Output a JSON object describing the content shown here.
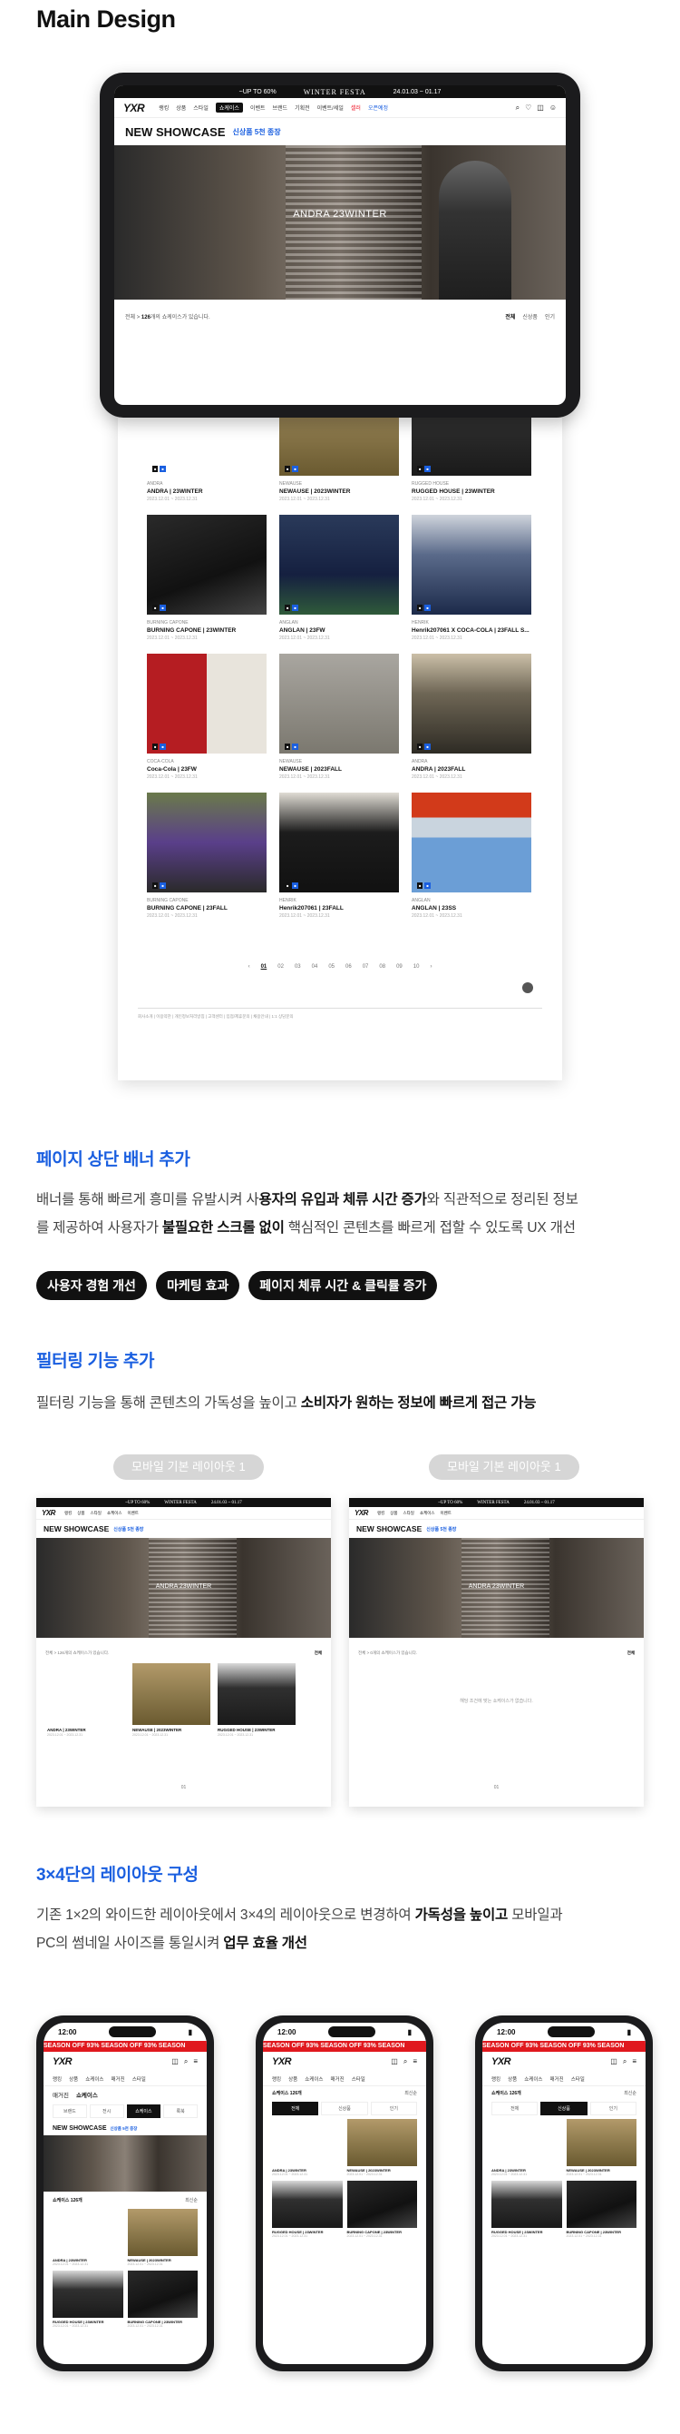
{
  "heading": "Main Design",
  "site": {
    "logo": "YXR",
    "promo_left": "~UP TO 60%",
    "promo_center": "WINTER FESTA",
    "promo_right": "24.01.03 ~ 01.17",
    "menu": [
      "랭킹",
      "상품",
      "스타일",
      "쇼케이스",
      "이벤트",
      "브랜드",
      "기획전",
      "이벤트/세일",
      "셀러",
      "오픈예정"
    ],
    "menu_active_index": 3,
    "menu_red_index": 8,
    "menu_blue_index": 9,
    "icons": [
      "search-icon",
      "heart-icon",
      "cart-icon",
      "user-icon"
    ]
  },
  "showcase": {
    "title": "NEW SHOWCASE",
    "subtitle": "신상품 5천 종장",
    "hero_label": "ANDRA 23WINTER",
    "result_text_prefix": "전체 > ",
    "result_count": "126",
    "result_text_suffix": "개의 쇼케이스가 있습니다.",
    "sort": [
      "전체",
      "신상품",
      "인기"
    ]
  },
  "cards": [
    {
      "brand": "ANDRA",
      "title": "ANDRA | 23WINTER",
      "date": "2023.12.01 ~ 2023.12.31",
      "thumb": "t1"
    },
    {
      "brand": "NEWAUSE",
      "title": "NEWAUSE | 2023WINTER",
      "date": "2023.12.01 ~ 2023.12.31",
      "thumb": "t2"
    },
    {
      "brand": "RUGGED HOUSE",
      "title": "RUGGED HOUSE | 23WINTER",
      "date": "2023.12.01 ~ 2023.12.31",
      "thumb": "t3"
    },
    {
      "brand": "BURNING CAPONE",
      "title": "BURNING CAPONE | 23WINTER",
      "date": "2023.12.01 ~ 2023.12.31",
      "thumb": "t4"
    },
    {
      "brand": "ANGLAN",
      "title": "ANGLAN | 23FW",
      "date": "2023.12.01 ~ 2023.12.31",
      "thumb": "t5"
    },
    {
      "brand": "HENRIK",
      "title": "Henrik207061 X COCA-COLA | 23FALL S...",
      "date": "2023.12.01 ~ 2023.12.31",
      "thumb": "t6"
    },
    {
      "brand": "COCA-COLA",
      "title": "Coca-Cola | 23FW",
      "date": "2023.12.01 ~ 2023.12.31",
      "thumb": "t7"
    },
    {
      "brand": "NEWAUSE",
      "title": "NEWAUSE | 2023FALL",
      "date": "2023.12.01 ~ 2023.12.31",
      "thumb": "t8"
    },
    {
      "brand": "ANDRA",
      "title": "ANDRA | 2023FALL",
      "date": "2023.12.01 ~ 2023.12.31",
      "thumb": "t9"
    },
    {
      "brand": "BURNING CAPONE",
      "title": "BURNING CAPONE | 23FALL",
      "date": "2023.12.01 ~ 2023.12.31",
      "thumb": "t10"
    },
    {
      "brand": "HENRIK",
      "title": "Henrik207061 | 23FALL",
      "date": "2023.12.01 ~ 2023.12.31",
      "thumb": "t11"
    },
    {
      "brand": "ANGLAN",
      "title": "ANGLAN | 23SS",
      "date": "2023.12.01 ~ 2023.12.31",
      "thumb": "t12"
    }
  ],
  "pagination": {
    "prev": "‹",
    "next": "›",
    "pages": [
      "01",
      "02",
      "03",
      "04",
      "05",
      "06",
      "07",
      "08",
      "09",
      "10"
    ],
    "current_index": 0
  },
  "footer_text": "회사소개 | 이용약관 | 개인정보처리방침 | 고객센터 | 입점/제휴문의 | 채용안내 | 1:1 상담문의",
  "section1": {
    "title": "페이지 상단 배너 추가",
    "line1_a": "배너를 통해 빠르게 흥미를 유발시켜 사",
    "line1_b": "용자의 유입과 체류 시간 증가",
    "line1_c": "와 직관적으로 정리된 정보",
    "line2_a": "를 제공하여 사용자가 ",
    "line2_b": "불필요한 스크롤 없이",
    "line2_c": " 핵심적인 콘텐츠를 빠르게 접할 수 있도록 UX 개선",
    "chips": [
      "사용자 경험 개선",
      "마케팅 효과",
      "페이지 체류 시간 & 클릭률 증가"
    ]
  },
  "section2": {
    "title": "필터링 기능 추가",
    "line_a": "필터링 기능을 통해 콘텐츠의 가독성을 높이고 ",
    "line_b": "소비자가 원하는 정보에 빠르게 접근 가능",
    "pill_left": "모바일 기본 레이아웃 1",
    "pill_right": "모바일 기본 레이아웃 1",
    "filter_left": "전체 > 126개의 쇼케이스가 있습니다.",
    "filter_right": "전체 > 0개의 쇼케이스가 있습니다.",
    "empty_text": "해당 조건에 맞는 쇼케이스가 없습니다.",
    "mini_cards": [
      {
        "title": "ANDRA | 23WINTER",
        "date": "2023.12.01 ~ 2023.12.31",
        "thumb": "t1"
      },
      {
        "title": "NEWAUSE | 2023WINTER",
        "date": "2023.12.01 ~ 2023.12.31",
        "thumb": "t2"
      },
      {
        "title": "RUGGED HOUSE | 23WINTER",
        "date": "2023.12.01 ~ 2023.12.31",
        "thumb": "t3"
      }
    ]
  },
  "section3": {
    "title": "3×4단의 레이아웃 구성",
    "line1_a": "기존 1×2의 와이드한 레이아웃에서 3×4의 레이아웃으로 변경하여 ",
    "line1_b": "가독성을 높이고",
    "line1_c": " 모바일과",
    "line2_a": "PC의 썸네일 사이즈를 통일시켜 ",
    "line2_b": "업무 효율 개선"
  },
  "phones": {
    "time": "12:00",
    "promo": "SEASON OFF 93%  SEASON OFF 93%  SEASON",
    "cats": [
      "랭킹",
      "상품",
      "쇼케이스",
      "매거진",
      "스타일",
      "기획전"
    ],
    "crumb_1": "매거진",
    "crumb_2": "쇼케이스",
    "tabs": [
      "브랜드",
      "전시",
      "쇼케이스",
      "룩북"
    ],
    "count_label": "쇼케이스 126개",
    "sort_label": "최신순",
    "cards": [
      {
        "title": "ANDRA | 23WINTER",
        "date": "2023.12.01 ~ 2023.12.31",
        "thumb": "t1"
      },
      {
        "title": "NEWAUSE | 2023WINTER",
        "date": "2023.12.01 ~ 2023.12.31",
        "thumb": "t2"
      },
      {
        "title": "RUGGED HOUSE | 23WINTER",
        "date": "2023.12.01 ~ 2023.12.31",
        "thumb": "t3"
      },
      {
        "title": "BURNING CAPONE | 23WINTER",
        "date": "2023.12.01 ~ 2023.12.31",
        "thumb": "t4"
      }
    ]
  },
  "colors": {
    "accent": "#1a5fe0",
    "promo_red": "#e0181e",
    "dark": "#111111"
  }
}
